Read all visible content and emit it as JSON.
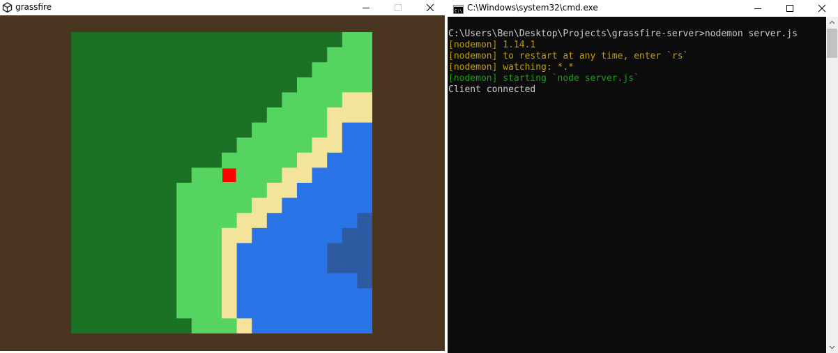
{
  "game_window": {
    "title": "grassfire",
    "icon": "unity-logo-icon",
    "controls": [
      "minimize-icon",
      "maximize-icon",
      "close-icon"
    ],
    "colors": {
      "border": "#4a3520",
      "forest": "#1b7224",
      "grass": "#56d462",
      "sand": "#f4e39a",
      "water": "#2a74e8",
      "deep_water": "#2d5aa0",
      "player": "#ff0000"
    },
    "map": {
      "tile_legend": {
        "F": "forest",
        "G": "grass",
        "S": "sand",
        "W": "water",
        "D": "deep_water"
      },
      "rows": [
        "FFFFFFFFFFFFFFFFFFGG",
        "FFFFFFFFFFFFFFFFFGGG",
        "FFFFFFFFFFFFFFFFGGGG",
        "FFFFFFFFFFFFFFFGGGGG",
        "FFFFFFFFFFFFFFGGGGSS",
        "FFFFFFFFFFFFFGGGGSSS",
        "FFFFFFFFFFFFGGGGGSWW",
        "FFFFFFFFFFFGGGGGSSWW",
        "FFFFFFFFFFGGGGGSSWWW",
        "FFFFFFFFGGGGGGSSWWWW",
        "FFFFFFFGGGGGGSSWWWWW",
        "FFFFFFFGGGGGSSWWWWWW",
        "FFFFFFFGGGGSSWWWWWWD",
        "FFFFFFFGGGSSWWWWWWDD",
        "FFFFFFFGGGSWWWWWWDDD",
        "FFFFFFFGGGSWWWWWWDDD",
        "FFFFFFFGGGSWWWWWWWWD",
        "FFFFFFFGGGSWWWWWWWWW",
        "FFFFFFFGGGSWWWWWWWWW",
        "FFFFFFFFGGGSWWWWWWWW"
      ],
      "player": {
        "row": 9,
        "col": 10
      }
    }
  },
  "console_window": {
    "title": "C:\\Windows\\system32\\cmd.exe",
    "icon": "cmd-prompt-icon",
    "controls": [
      "minimize-icon",
      "maximize-icon",
      "close-icon"
    ],
    "lines": [
      {
        "text": "C:\\Users\\Ben\\Desktop\\Projects\\grassfire-server>nodemon server.js",
        "color": "#cccccc"
      },
      {
        "text": "[nodemon] 1.14.1",
        "color": "#c19c00"
      },
      {
        "text": "[nodemon] to restart at any time, enter `rs`",
        "color": "#c19c00"
      },
      {
        "text": "[nodemon] watching: *.*",
        "color": "#c19c00"
      },
      {
        "text": "[nodemon] starting `node server.js`",
        "color": "#13a10e"
      },
      {
        "text": "Client connected",
        "color": "#cccccc"
      }
    ]
  }
}
